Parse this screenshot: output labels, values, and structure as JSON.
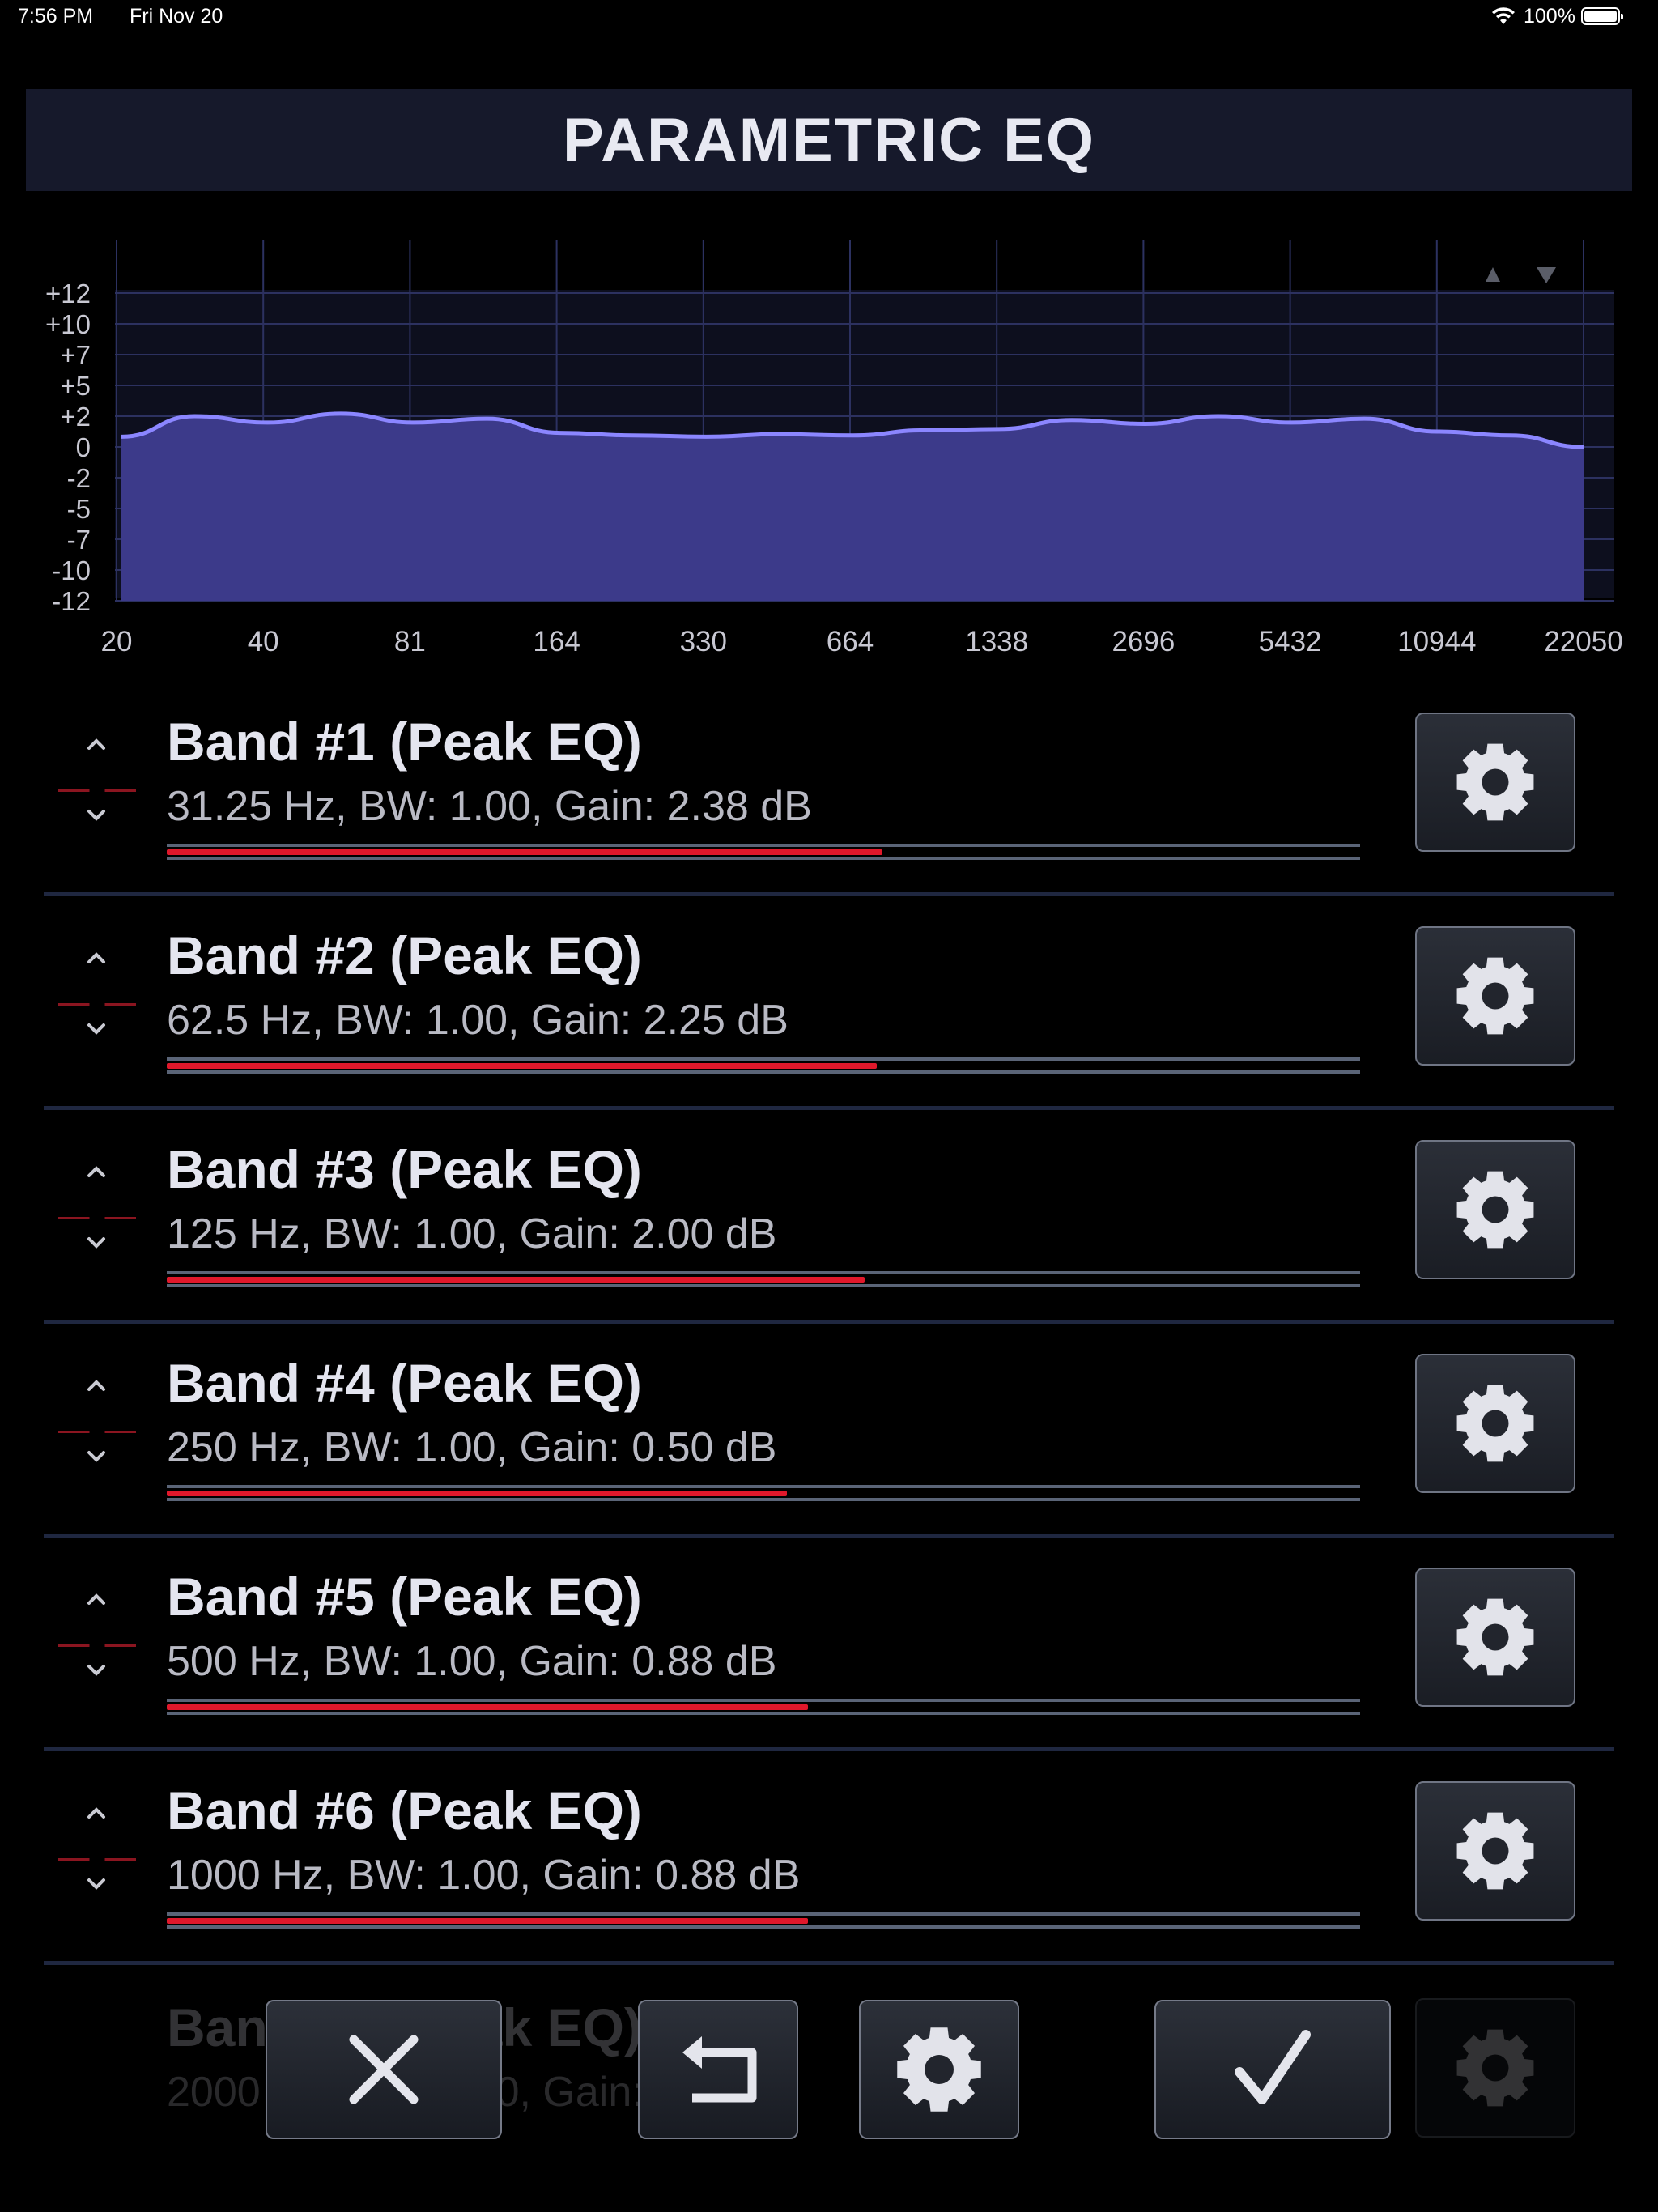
{
  "status_bar": {
    "time": "7:56 PM",
    "date": "Fri Nov 20",
    "battery": "100%"
  },
  "title": "PARAMETRIC EQ",
  "graph": {
    "y_ticks": [
      "+12",
      "+10",
      "+7",
      "+5",
      "+2",
      "0",
      "-2",
      "-5",
      "-7",
      "-10",
      "-12"
    ],
    "x_ticks": [
      "20",
      "40",
      "81",
      "164",
      "330",
      "664",
      "1338",
      "2696",
      "5432",
      "10944",
      "22050"
    ],
    "curve_db": [
      0.8,
      2.4,
      1.9,
      2.6,
      1.9,
      2.2,
      1.1,
      0.9,
      0.8,
      1.0,
      0.9,
      1.3,
      1.4,
      2.1,
      1.8,
      2.4,
      1.9,
      2.2,
      1.2,
      0.9,
      0.0
    ],
    "fill_color": "#3c3a8a",
    "line_color": "#8b86ff",
    "nav_up_icon": "triangle-up-icon",
    "nav_down_icon": "triangle-down-icon"
  },
  "bands": [
    {
      "name": "Band #1 (Peak EQ)",
      "params": "31.25 Hz, BW: 1.00, Gain: 2.38 dB",
      "level": 0.6
    },
    {
      "name": "Band #2 (Peak EQ)",
      "params": "62.5 Hz, BW: 1.00, Gain: 2.25 dB",
      "level": 0.595
    },
    {
      "name": "Band #3 (Peak EQ)",
      "params": "125 Hz, BW: 1.00, Gain: 2.00 dB",
      "level": 0.585
    },
    {
      "name": "Band #4 (Peak EQ)",
      "params": "250 Hz, BW: 1.00, Gain: 0.50 dB",
      "level": 0.52
    },
    {
      "name": "Band #5 (Peak EQ)",
      "params": "500 Hz, BW: 1.00, Gain: 0.88 dB",
      "level": 0.537
    },
    {
      "name": "Band #6 (Peak EQ)",
      "params": "1000 Hz, BW: 1.00, Gain: 0.88 dB",
      "level": 0.537
    }
  ],
  "partial_band": {
    "name": "Band #7 (Peak EQ)",
    "params": "2000 Hz, BW: 1.00, Gain: 0.88 dB"
  },
  "toolbar": {
    "cancel_icon": "close-icon",
    "undo_icon": "undo-icon",
    "settings_icon": "gear-icon",
    "confirm_icon": "checkmark-icon"
  },
  "colors": {
    "accent_red": "#e0182b",
    "title_bg": "#16192b"
  }
}
